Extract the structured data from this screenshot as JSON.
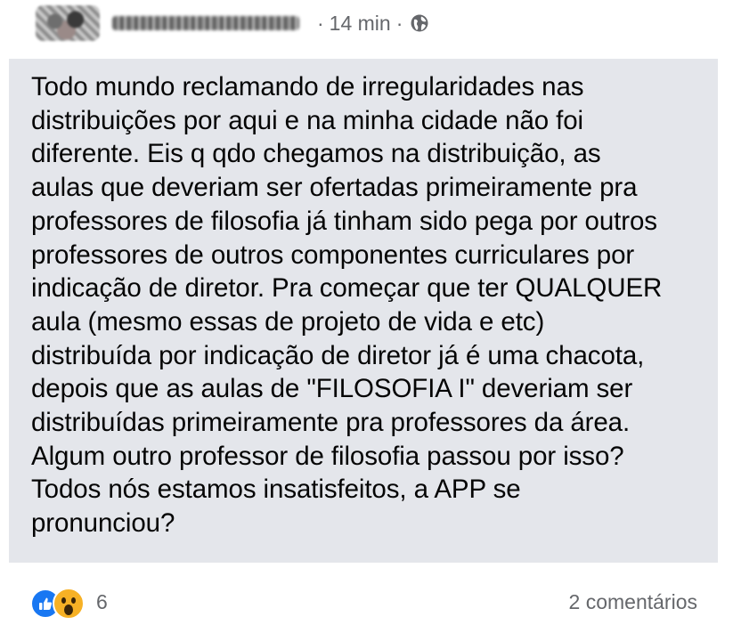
{
  "post": {
    "timestamp": "14 min",
    "separator": "·",
    "privacy_icon": "globe-icon",
    "author_name_redacted": true,
    "body": "Todo mundo reclamando de irregularidades nas\ndistribuições por aqui e na minha cidade não foi\ndiferente. Eis q qdo chegamos na distribuição, as\naulas que deveriam ser ofertadas primeiramente pra\nprofessores de filosofia já tinham sido pega por outros\nprofessores de outros componentes curriculares por\nindicação de diretor. Pra começar que ter QUALQUER\naula (mesmo essas de projeto de vida e etc)\ndistribuída por indicação de diretor já é uma chacota,\ndepois que as aulas de \"FILOSOFIA I\" deveriam ser\ndistribuídas primeiramente pra professores da área.\nAlgum outro professor de filosofia passou por isso?\nTodos nós estamos insatisfeitos, a APP se\npronunciou?",
    "body_background": "#e4e6eb"
  },
  "footer": {
    "reactions": [
      "like-icon",
      "wow-icon"
    ],
    "reaction_count": "6",
    "comments": "2 comentários"
  },
  "colors": {
    "like": "#1877f2",
    "wow": "#f7b125",
    "meta_text": "#65676b"
  }
}
